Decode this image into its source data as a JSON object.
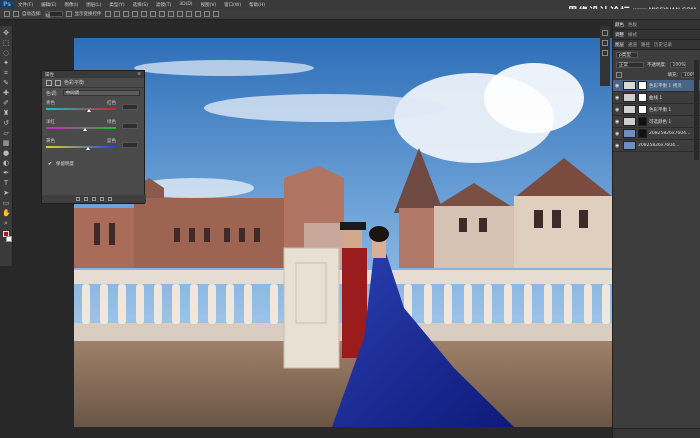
{
  "menubar": {
    "logo": "Ps",
    "items": [
      "文件(F)",
      "编辑(E)",
      "图像(I)",
      "图层(L)",
      "类型(Y)",
      "选择(S)",
      "滤镜(T)",
      "3D(D)",
      "视图(V)",
      "窗口(W)",
      "帮助(H)"
    ]
  },
  "watermark": {
    "cn": "思缘设计论坛",
    "en": "www.MISSYUAN.COM"
  },
  "options": {
    "auto_select": "自动选择:",
    "group": "组",
    "show_transform": "显示变换控件"
  },
  "tools": [
    "move-icon",
    "marquee-icon",
    "lasso-icon",
    "magic-wand-icon",
    "crop-icon",
    "eyedropper-icon",
    "heal-icon",
    "brush-icon",
    "stamp-icon",
    "history-brush-icon",
    "eraser-icon",
    "gradient-icon",
    "blur-icon",
    "dodge-icon",
    "pen-icon",
    "type-icon",
    "path-select-icon",
    "shape-icon",
    "hand-icon",
    "zoom-icon"
  ],
  "colors": {
    "foreground": "#b01818",
    "background": "#ffffff",
    "selected_layer": "#4a6486"
  },
  "color_balance": {
    "header": "属性",
    "title": "色彩平衡",
    "tone_label": "色调:",
    "tone_value": "中间调",
    "sliders": [
      {
        "left": "青色",
        "right": "红色",
        "value": "",
        "level": 0.62,
        "track": "cyan-red"
      },
      {
        "left": "洋红",
        "right": "绿色",
        "value": "",
        "level": 0.55,
        "track": "magenta-green"
      },
      {
        "left": "黄色",
        "right": "蓝色",
        "value": "",
        "level": 0.6,
        "track": "yellow-blue"
      }
    ],
    "preserve_luminosity": "保留明度"
  },
  "right_panel": {
    "tabs_top": [
      "颜色",
      "色板"
    ],
    "tabs_mid": [
      "调整",
      "样式"
    ],
    "tabs_layers": [
      "图层",
      "通道",
      "路径",
      "历史记录"
    ],
    "kind_label": "ρ类型",
    "blend_mode": "正常",
    "opacity_label": "不透明度:",
    "opacity_value": "100%",
    "fill_label": "填充:",
    "fill_value": "100%",
    "layers": [
      {
        "name": "色彩平衡 1 拷贝",
        "selected": true
      },
      {
        "name": "曲线 1",
        "selected": false
      },
      {
        "name": "色彩平衡 1",
        "selected": false
      },
      {
        "name": "可选颜色 1",
        "selected": false
      },
      {
        "name": "20825826x7604...",
        "selected": false
      },
      {
        "name": "20825826x7604...",
        "selected": false
      }
    ]
  }
}
